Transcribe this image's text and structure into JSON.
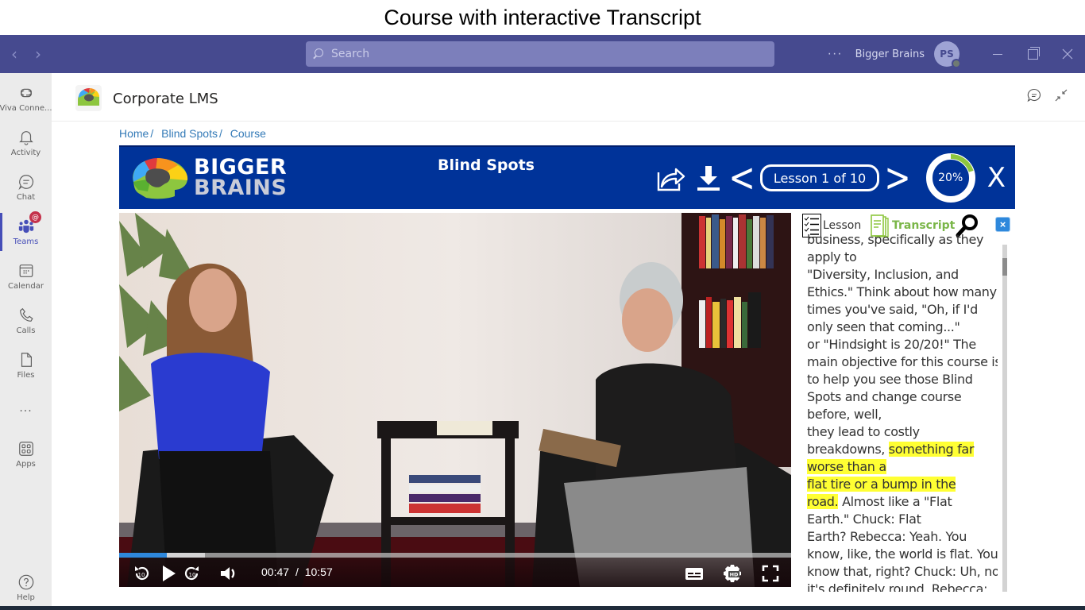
{
  "caption": "Course with interactive Transcript",
  "titlebar": {
    "back_icon": "chevron-left-icon",
    "forward_icon": "chevron-right-icon",
    "search_placeholder": "Search",
    "more": "···",
    "org_name": "Bigger Brains",
    "avatar_initials": "PS",
    "presence": "available"
  },
  "rail": {
    "items": [
      {
        "label": "Viva Conne...",
        "icon": "viva-connections-icon"
      },
      {
        "label": "Activity",
        "icon": "bell-icon"
      },
      {
        "label": "Chat",
        "icon": "chat-icon"
      },
      {
        "label": "Teams",
        "icon": "teams-icon",
        "active": true,
        "badge": "@"
      },
      {
        "label": "Calendar",
        "icon": "calendar-icon"
      },
      {
        "label": "Calls",
        "icon": "phone-icon"
      },
      {
        "label": "Files",
        "icon": "file-icon"
      },
      {
        "label": "...",
        "icon": "more-icon"
      },
      {
        "label": "Apps",
        "icon": "apps-icon"
      },
      {
        "label": "Help",
        "icon": "help-icon"
      }
    ]
  },
  "app": {
    "title": "Corporate LMS",
    "header_icons": [
      "chat-bubble-icon",
      "collapse-icon"
    ]
  },
  "breadcrumb": [
    {
      "label": "Home"
    },
    {
      "label": "Blind Spots"
    },
    {
      "label": "Course"
    }
  ],
  "banner": {
    "logo_line1": "BIGGER",
    "logo_line2": "BRAINS",
    "course_title": "Blind Spots",
    "lesson_label": "Lesson 1 of 10",
    "progress_percent": 20,
    "progress_label": "20%",
    "close_label": "X",
    "prev": "<",
    "next": ">",
    "colors": {
      "banner_bg": "#003399",
      "progress": "#8dc63f"
    }
  },
  "video": {
    "current_time": "00:47",
    "separator": "/",
    "duration": "10:57",
    "played_fraction": 0.071,
    "buffered_fraction": 0.128,
    "controls": [
      "rewind-10-icon",
      "play-icon",
      "forward-10-icon",
      "volume-icon",
      "captions-icon",
      "hd-settings-icon",
      "fullscreen-icon"
    ]
  },
  "side_panel": {
    "tabs": [
      {
        "label": "Lesson",
        "icon": "checklist-icon"
      },
      {
        "label": "Transcript",
        "icon": "transcript-icon",
        "active": true
      }
    ],
    "search_icon": "magnifier-icon",
    "close_label": "×"
  },
  "transcript": {
    "lines": [
      {
        "segments": [
          {
            "text": "business, specifically as they",
            "hl": false
          }
        ]
      },
      {
        "segments": [
          {
            "text": "apply to",
            "hl": false
          }
        ]
      },
      {
        "segments": [
          {
            "text": "\"Diversity, Inclusion, and",
            "hl": false
          }
        ]
      },
      {
        "segments": [
          {
            "text": "Ethics.\" Think about how many",
            "hl": false
          }
        ]
      },
      {
        "segments": [
          {
            "text": "times you've said, \"Oh, if I'd",
            "hl": false
          }
        ]
      },
      {
        "segments": [
          {
            "text": "only seen that coming...\"",
            "hl": false
          }
        ]
      },
      {
        "segments": [
          {
            "text": "or \"Hindsight is 20/20!\" The",
            "hl": false
          }
        ]
      },
      {
        "segments": [
          {
            "text": "main objective for this course is",
            "hl": false
          }
        ]
      },
      {
        "segments": [
          {
            "text": "to help you see those Blind",
            "hl": false
          }
        ]
      },
      {
        "segments": [
          {
            "text": "Spots and change course",
            "hl": false
          }
        ]
      },
      {
        "segments": [
          {
            "text": "before, well,",
            "hl": false
          }
        ]
      },
      {
        "segments": [
          {
            "text": "they lead to costly",
            "hl": false
          }
        ]
      },
      {
        "segments": [
          {
            "text": "breakdowns, ",
            "hl": false
          },
          {
            "text": "something far",
            "hl": true
          }
        ]
      },
      {
        "segments": [
          {
            "text": "worse than a",
            "hl": true
          }
        ]
      },
      {
        "segments": [
          {
            "text": "flat tire or a bump in the",
            "hl": true
          }
        ]
      },
      {
        "segments": [
          {
            "text": "road.",
            "hl": true
          },
          {
            "text": " Almost like a \"Flat",
            "hl": false
          }
        ]
      },
      {
        "segments": [
          {
            "text": "Earth.\" Chuck: Flat",
            "hl": false
          }
        ]
      },
      {
        "segments": [
          {
            "text": "Earth? Rebecca: Yeah. You",
            "hl": false
          }
        ]
      },
      {
        "segments": [
          {
            "text": "know, like, the world is flat. You",
            "hl": false
          }
        ]
      },
      {
        "segments": [
          {
            "text": "know that, right? Chuck: Uh, no,",
            "hl": false
          }
        ]
      },
      {
        "segments": [
          {
            "text": "it's definitely round. Rebecca:",
            "hl": false
          }
        ]
      }
    ],
    "scroll_position_fraction": 0.04
  }
}
